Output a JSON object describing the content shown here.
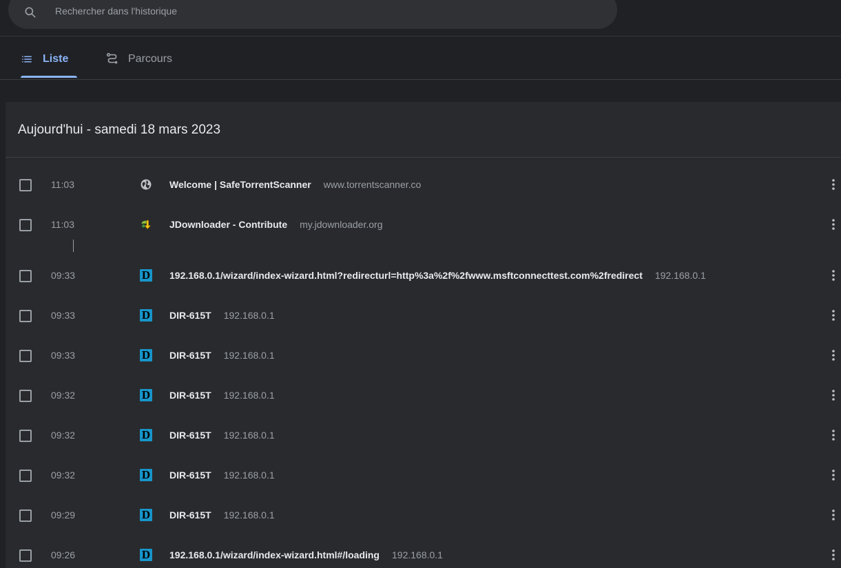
{
  "search": {
    "placeholder": "Rechercher dans l'historique"
  },
  "tabs": [
    {
      "label": "Liste",
      "icon": "list-icon",
      "active": true
    },
    {
      "label": "Parcours",
      "icon": "journeys-icon",
      "active": false
    }
  ],
  "day": {
    "title": "Aujourd'hui - samedi 18 mars 2023"
  },
  "rows": [
    {
      "time": "11:03",
      "icon": "globe-icon",
      "title": "Welcome | SafeTorrentScanner",
      "domain": "www.torrentscanner.co"
    },
    {
      "time": "11:03",
      "icon": "jdownloader-icon",
      "title": "JDownloader - Contribute",
      "domain": "my.jdownloader.org"
    },
    {
      "time": "09:33",
      "icon": "dlink-icon",
      "title": "192.168.0.1/wizard/index-wizard.html?redirecturl=http%3a%2f%2fwww.msftconnecttest.com%2fredirect",
      "domain": "192.168.0.1"
    },
    {
      "time": "09:33",
      "icon": "dlink-icon",
      "title": "DIR-615T",
      "domain": "192.168.0.1"
    },
    {
      "time": "09:33",
      "icon": "dlink-icon",
      "title": "DIR-615T",
      "domain": "192.168.0.1"
    },
    {
      "time": "09:32",
      "icon": "dlink-icon",
      "title": "DIR-615T",
      "domain": "192.168.0.1"
    },
    {
      "time": "09:32",
      "icon": "dlink-icon",
      "title": "DIR-615T",
      "domain": "192.168.0.1"
    },
    {
      "time": "09:32",
      "icon": "dlink-icon",
      "title": "DIR-615T",
      "domain": "192.168.0.1"
    },
    {
      "time": "09:29",
      "icon": "dlink-icon",
      "title": "DIR-615T",
      "domain": "192.168.0.1"
    },
    {
      "time": "09:26",
      "icon": "dlink-icon",
      "title": "192.168.0.1/wizard/index-wizard.html#/loading",
      "domain": "192.168.0.1"
    }
  ],
  "dlink_letter": "D",
  "colors": {
    "background": "#202124",
    "card": "#292a2d",
    "accent": "#8ab4f8",
    "secondary_text": "#9aa0a6",
    "dlink_blue": "#1795c9"
  }
}
